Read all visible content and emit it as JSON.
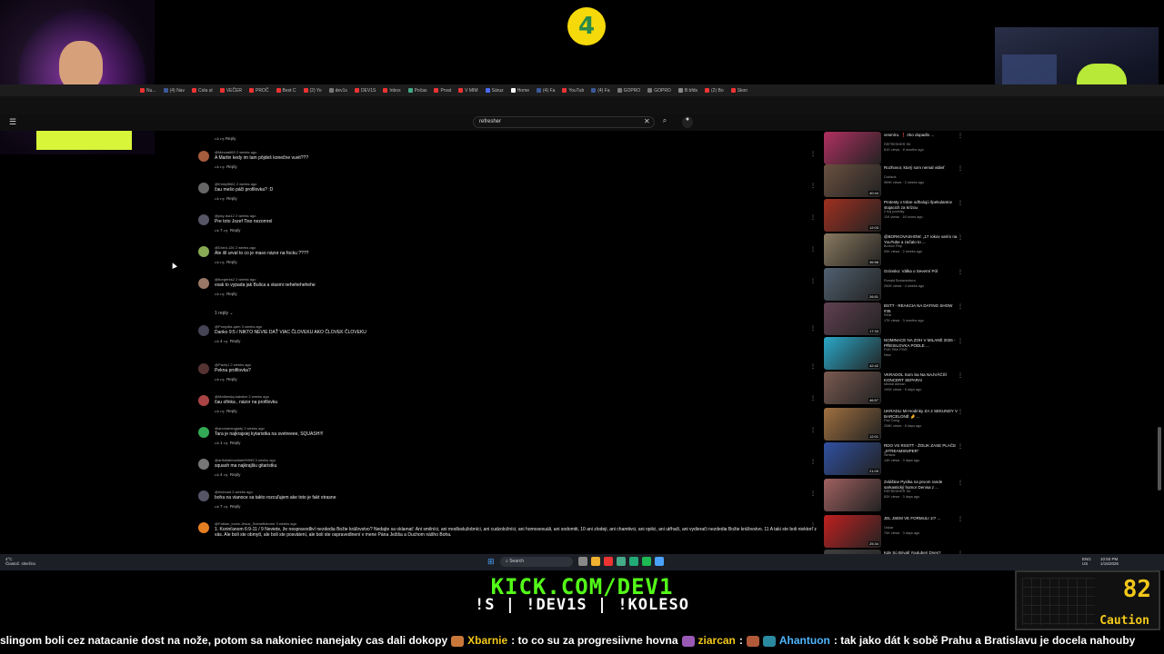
{
  "stream_logo_text": "4",
  "browser_tabs": [
    {
      "label": "Nu...",
      "color": "#e33"
    },
    {
      "label": "(4) Nav",
      "color": "#3b5998"
    },
    {
      "label": "Cola ut",
      "color": "#e33"
    },
    {
      "label": "VEČER",
      "color": "#e33"
    },
    {
      "label": "PROČ",
      "color": "#e33"
    },
    {
      "label": "Best C",
      "color": "#e33"
    },
    {
      "label": "(2) Yo",
      "color": "#e33"
    },
    {
      "label": "dev1s",
      "color": "#777"
    },
    {
      "label": "DEV1S",
      "color": "#e33"
    },
    {
      "label": "Inbox",
      "color": "#e33"
    },
    {
      "label": "Počas",
      "color": "#4a8"
    },
    {
      "label": "Prvat",
      "color": "#e33"
    },
    {
      "label": "V MIM",
      "color": "#e33"
    },
    {
      "label": "Sáruz",
      "color": "#4a6cf7"
    },
    {
      "label": "Home",
      "color": "#fff"
    },
    {
      "label": "(4) Fa",
      "color": "#3b5998"
    },
    {
      "label": "YouTub",
      "color": "#e33"
    },
    {
      "label": "(4) Fa",
      "color": "#3b5998"
    },
    {
      "label": "GOPRO",
      "color": "#777"
    },
    {
      "label": "GOPRO",
      "color": "#777"
    },
    {
      "label": "B bfds",
      "color": "#888"
    },
    {
      "label": "(2) Bo",
      "color": "#e33"
    },
    {
      "label": "Skon",
      "color": "#e33"
    }
  ],
  "youtube": {
    "search_value": "refresher",
    "clear_icon": "close-icon",
    "search_icon": "search-icon",
    "mic_icon": "mic-icon"
  },
  "comments": {
    "top_reply_label": "Reply",
    "replies_toggle": "1 reply",
    "items": [
      {
        "user": "@Mezaa669",
        "age": "2 weeks ago",
        "text": "A Martin kedy im tam pôjdeš konečne vuvit???",
        "likes": "",
        "reply": "Reply",
        "avatar": "#a55b3c"
      },
      {
        "user": "@Kinky5661",
        "age": "2 weeks ago",
        "text": "čau mešo páči profilovka? :D",
        "likes": "",
        "reply": "Reply",
        "avatar": "#666"
      },
      {
        "user": "@pay-rka12",
        "age": "2 weeks ago",
        "text": "Pre toto Jozef Tiso nezomrel",
        "likes": "7",
        "reply": "Reply",
        "avatar": "#556"
      },
      {
        "user": "@Drahi-126",
        "age": "2 weeks ago",
        "text": "Ale išl urval to co je maso názor na focku ????",
        "likes": "",
        "reply": "Reply",
        "avatar": "#8a5"
      },
      {
        "user": "@burgerks2",
        "age": "2 weeks ago",
        "text": "vsak to vypada jak Bulica a vlasmi nehehehehehe",
        "likes": "",
        "reply": "Reply",
        "avatar": "#976"
      },
      {
        "user": "@Pompilla-qdm",
        "age": "3 weeks ago",
        "text": "Danko 9:5 / NIKTO NEVIE DAŤ VIAC ČLOVEKU AKO ČLOVEK ČLOVEKU",
        "likes": "4",
        "reply": "Reply",
        "avatar": "#445"
      },
      {
        "user": "@Pazty1",
        "age": "2 weeks ago",
        "text": "Pekna profilovka?",
        "likes": "",
        "reply": "Reply",
        "avatar": "#533"
      },
      {
        "user": "@Mafiánsky.kabátor",
        "age": "2 weeks ago",
        "text": "čau ofinka , názor na profilovku",
        "likes": "",
        "reply": "Reply",
        "avatar": "#a44"
      },
      {
        "user": "@arcmamingjady",
        "age": "2 weeks ago",
        "text": "Tara je najkrajsiej kytaristka na svetreeee, SQUASH!!!",
        "likes": "1",
        "reply": "Reply",
        "avatar": "#3a5"
      },
      {
        "user": "@artfoltallmadlate99999",
        "age": "3 weeks ago",
        "text": "squash ma najkrajšiu gitaristku",
        "likes": "4",
        "reply": "Reply",
        "avatar": "#777"
      },
      {
        "user": "@hlubcad",
        "age": "2 weeks ago",
        "text": "boha na vianoce sa takto rozcuľujem ake toto je fakt otrasne",
        "likes": "7",
        "reply": "Reply",
        "avatar": "#556"
      },
      {
        "user": "@Fabian_loves.Jesus_Submittotome",
        "age": "3 weeks ago",
        "text": "1. Korinťanom 6:9-11 / 9 Neviete, že nespravodliví nezdedia Božie kráľovstvo? Nedajte sa oklamať: Ani smilníci, ani modloslužobníci, ani cudzoložníci, ani homosexuáli, ani sodomiti, 10 ani zlodeji, ani chamtivci, ani opilci, ani utŕhači, ani vydierači nezdedia Božie kráľovstvo. 11 A taki ste boli niektorí z vás. Ale boli ste obmytí, ale boli ste posvätení, ale boli ste ospravedlnení v mene Pána Ježiša a Duchom nášho Boha.",
        "likes": "",
        "reply": "",
        "avatar": "#e67e22"
      }
    ]
  },
  "sidebar_videos": [
    {
      "title": "vesmíru. ❗ Ako dopadlo ...",
      "channel": "REFRESHER SK",
      "meta": "81K views · 8 months ago",
      "duration": "",
      "thumb": "#b03060"
    },
    {
      "title": "Rozhovor, ktorý som nemal vidieť",
      "channel": "Dukisok",
      "meta": "969K views · 2 weeks ago",
      "duration": "40:44",
      "thumb": "#6a5040"
    },
    {
      "title": "Protesty v tráne odhalujú špekulantov stojacich za krízou",
      "channel": "2 boj podniky",
      "meta": "11K views · 16 hours ago",
      "duration": "12:03",
      "thumb": "#a03020"
    },
    {
      "title": "@BORKOVASHOW: „17 rokov varím na YouTube a začalo to ...",
      "channel": "Borkov Filip",
      "meta": "90K views · 2 weeks ago",
      "duration": "36:58",
      "thumb": "#8a7a60"
    },
    {
      "title": "Grónsko: Válka o Severní Pól",
      "channel": "Ronald Bonaventura",
      "meta": "260K views · 4 weeks ago",
      "duration": "26:51",
      "thumb": "#506070"
    },
    {
      "title": "BSTT - REAKCIA NA DATING SHOW #35",
      "channel": "Rela",
      "meta": "17K views · 3 months ago",
      "duration": "17:33",
      "thumb": "#604050"
    },
    {
      "title": "NOMINACE NA ZOH V MILANĚ 2026 - PŘESILOVKA PODLE ...",
      "channel": "PUK PAK PIVE",
      "meta": "New",
      "duration": "42:42",
      "thumb": "#2aa8c8"
    },
    {
      "title": "VKRADOL Som Sa Na NAJVÄČŠÍ KONCERT SEPARA!",
      "channel": "Michal Alexan",
      "meta": "100K views · 5 days ago",
      "duration": "46:57",
      "thumb": "#7a5a50"
    },
    {
      "title": "UKRADLI MI Hodinky ZA 2 SEKUNDY V BARCELONĚ 🤌 ...",
      "channel": "Pan Čang",
      "meta": "208K views · 8 days ago",
      "duration": "12:01",
      "thumb": "#a07040"
    },
    {
      "title": "RDO VS RSSTT - ŽOLIK ZASE PLAČE „STREAMSNIPER“",
      "channel": "Simsos",
      "meta": "14K views · 3 days ago",
      "duration": "21:09",
      "thumb": "#3050a0"
    },
    {
      "title": "Zvláštne Pyslka na prvom rande sarkastický humor Denisa z ...",
      "channel": "REFRESHER SK",
      "meta": "82K views · 3 days ago",
      "duration": "",
      "thumb": "#a06060"
    },
    {
      "title": "JEL JSEM VE FORMULI 1!? ...",
      "channel": "Oskar",
      "meta": "70K views · 3 days ago",
      "duration": "25:34",
      "thumb": "#c02020"
    },
    {
      "title": "Kde Sú Bývalí Youtuberi Dnes?",
      "channel": "",
      "meta": "",
      "duration": "",
      "thumb": "#404040"
    }
  ],
  "taskbar": {
    "weather_temp": "4°C",
    "weather_desc": "Čiastoč. slnečno",
    "search_label": "Search",
    "lang": "ENG",
    "lang_sub": "US",
    "time": "10:50 PM",
    "date": "1/15/2026",
    "app_colors": [
      "#888",
      "#f0b030",
      "#e33",
      "#4a8",
      "#2a7",
      "#1db954",
      "#4aa3ff"
    ]
  },
  "overlay": {
    "kick_text": "KICK.COM/DEV1",
    "commands_text": "!S | !DEV1S | !KOLESO",
    "gauge_value": "82",
    "gauge_label": "Caution"
  },
  "chat_ticker": [
    {
      "type": "msg",
      "text": "slingom boli cez natacanie dost na nože, potom sa nakoniec nanejaky cas dali dokopy"
    },
    {
      "type": "emote",
      "color": "#c9783a"
    },
    {
      "type": "user",
      "text": "Xbarnie",
      "color": "#f2c81a"
    },
    {
      "type": "msg",
      "text": ": to co su za progresiivne hovna"
    },
    {
      "type": "emote",
      "color": "#9b59b6"
    },
    {
      "type": "user",
      "text": "ziarcan",
      "color": "#f2c81a"
    },
    {
      "type": "msg",
      "text": ":"
    },
    {
      "type": "emote",
      "color": "#b05a3a"
    },
    {
      "type": "emote",
      "color": "#2a8aa0"
    },
    {
      "type": "user",
      "text": "Ahantuon",
      "color": "#4fb6ff"
    },
    {
      "type": "msg",
      "text": ": tak jako dát k sobě Prahu a Bratislavu je docela nahouby"
    }
  ]
}
